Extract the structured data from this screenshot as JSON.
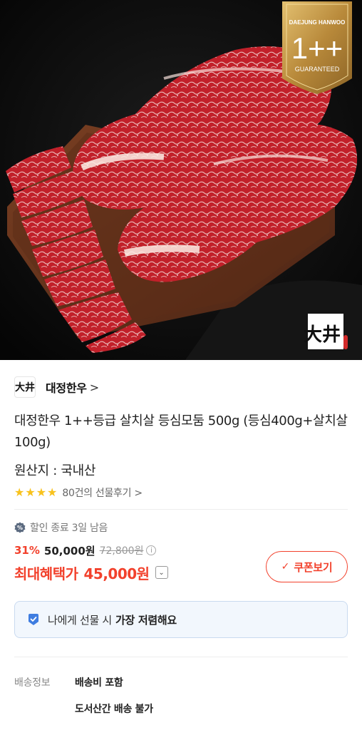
{
  "hero": {
    "badge_brand": "DAEJUNG HANWOO",
    "badge_grade": "1++",
    "badge_guarantee": "GUARANTEED",
    "brand_mark": "大井"
  },
  "store": {
    "logo_mark": "大井",
    "name": "대정한우",
    "chevron": ">"
  },
  "product": {
    "title": "대정한우 1++등급 살치살 등심모둠 500g (등심400g+살치살100g)",
    "origin": "원산지 : 국내산",
    "rating_stars": 4,
    "review_link": "80건의 선물후기 >"
  },
  "sale": {
    "notice": "할인 종료 3일 남음",
    "discount_rate": "31%",
    "price": "50,000원",
    "original_price": "72,800원",
    "info_symbol": "i",
    "max_benefit_label": "최대혜택가",
    "max_benefit_price": "45,000원",
    "dropdown_symbol": "⌄"
  },
  "coupon": {
    "check": "✓",
    "label": "쿠폰보기"
  },
  "gift_banner": {
    "text": "나에게 선물 시",
    "strong": "가장 저렴해요"
  },
  "shipping": {
    "label": "배송정보",
    "value1": "배송비 포함",
    "value2": "도서산간 배송 불가"
  },
  "colors": {
    "accent_red": "#f2412c",
    "star_yellow": "#f8c21d",
    "badge_gold": "#c59a3e",
    "gift_bg": "#f2f7fd"
  },
  "icons": [
    "sale-badge-icon",
    "info-icon",
    "chevron-down-icon",
    "check-icon",
    "gift-tag-icon",
    "star-icon"
  ]
}
